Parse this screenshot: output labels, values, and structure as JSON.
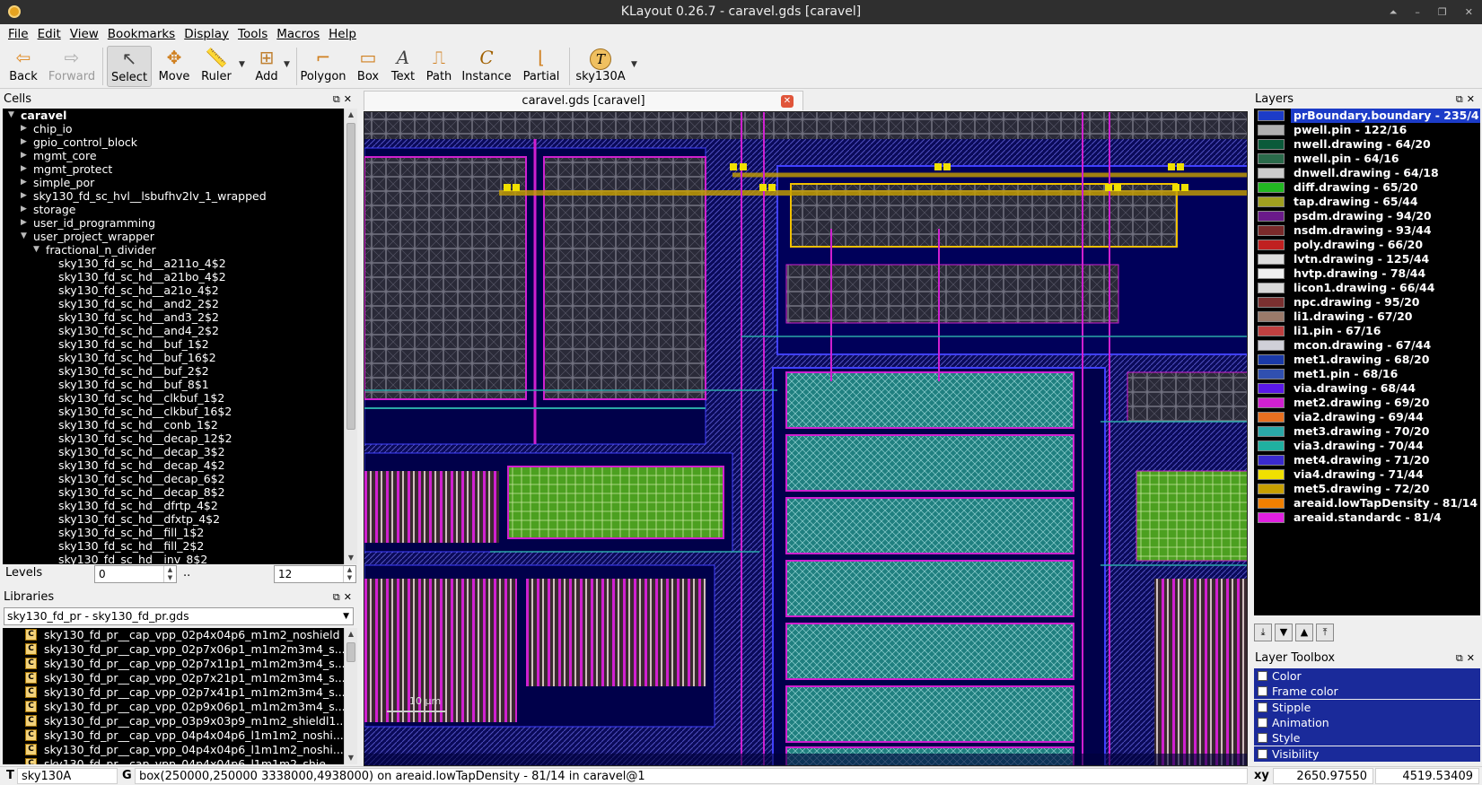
{
  "window": {
    "title": "KLayout 0.26.7 - caravel.gds [caravel]"
  },
  "menu": [
    "File",
    "Edit",
    "View",
    "Bookmarks",
    "Display",
    "Tools",
    "Macros",
    "Help"
  ],
  "toolbar": {
    "back": "Back",
    "forward": "Forward",
    "select": "Select",
    "move": "Move",
    "ruler": "Ruler",
    "add": "Add",
    "polygon": "Polygon",
    "box": "Box",
    "text": "Text",
    "path": "Path",
    "instance": "Instance",
    "partial": "Partial",
    "tech": "sky130A"
  },
  "cells_panel": {
    "title": "Cells",
    "tree": [
      {
        "label": "caravel",
        "depth": 0,
        "expander": "open",
        "bold": true
      },
      {
        "label": "chip_io",
        "depth": 1,
        "expander": "closed"
      },
      {
        "label": "gpio_control_block",
        "depth": 1,
        "expander": "closed"
      },
      {
        "label": "mgmt_core",
        "depth": 1,
        "expander": "closed"
      },
      {
        "label": "mgmt_protect",
        "depth": 1,
        "expander": "closed"
      },
      {
        "label": "simple_por",
        "depth": 1,
        "expander": "closed"
      },
      {
        "label": "sky130_fd_sc_hvl__lsbufhv2lv_1_wrapped",
        "depth": 1,
        "expander": "closed"
      },
      {
        "label": "storage",
        "depth": 1,
        "expander": "closed"
      },
      {
        "label": "user_id_programming",
        "depth": 1,
        "expander": "closed"
      },
      {
        "label": "user_project_wrapper",
        "depth": 1,
        "expander": "open"
      },
      {
        "label": "fractional_n_divider",
        "depth": 2,
        "expander": "open"
      },
      {
        "label": "sky130_fd_sc_hd__a211o_4$2",
        "depth": 3,
        "expander": "none"
      },
      {
        "label": "sky130_fd_sc_hd__a21bo_4$2",
        "depth": 3,
        "expander": "none"
      },
      {
        "label": "sky130_fd_sc_hd__a21o_4$2",
        "depth": 3,
        "expander": "none"
      },
      {
        "label": "sky130_fd_sc_hd__and2_2$2",
        "depth": 3,
        "expander": "none"
      },
      {
        "label": "sky130_fd_sc_hd__and3_2$2",
        "depth": 3,
        "expander": "none"
      },
      {
        "label": "sky130_fd_sc_hd__and4_2$2",
        "depth": 3,
        "expander": "none"
      },
      {
        "label": "sky130_fd_sc_hd__buf_1$2",
        "depth": 3,
        "expander": "none"
      },
      {
        "label": "sky130_fd_sc_hd__buf_16$2",
        "depth": 3,
        "expander": "none"
      },
      {
        "label": "sky130_fd_sc_hd__buf_2$2",
        "depth": 3,
        "expander": "none"
      },
      {
        "label": "sky130_fd_sc_hd__buf_8$1",
        "depth": 3,
        "expander": "none"
      },
      {
        "label": "sky130_fd_sc_hd__clkbuf_1$2",
        "depth": 3,
        "expander": "none"
      },
      {
        "label": "sky130_fd_sc_hd__clkbuf_16$2",
        "depth": 3,
        "expander": "none"
      },
      {
        "label": "sky130_fd_sc_hd__conb_1$2",
        "depth": 3,
        "expander": "none"
      },
      {
        "label": "sky130_fd_sc_hd__decap_12$2",
        "depth": 3,
        "expander": "none"
      },
      {
        "label": "sky130_fd_sc_hd__decap_3$2",
        "depth": 3,
        "expander": "none"
      },
      {
        "label": "sky130_fd_sc_hd__decap_4$2",
        "depth": 3,
        "expander": "none"
      },
      {
        "label": "sky130_fd_sc_hd__decap_6$2",
        "depth": 3,
        "expander": "none"
      },
      {
        "label": "sky130_fd_sc_hd__decap_8$2",
        "depth": 3,
        "expander": "none"
      },
      {
        "label": "sky130_fd_sc_hd__dfrtp_4$2",
        "depth": 3,
        "expander": "none"
      },
      {
        "label": "sky130_fd_sc_hd__dfxtp_4$2",
        "depth": 3,
        "expander": "none"
      },
      {
        "label": "sky130_fd_sc_hd__fill_1$2",
        "depth": 3,
        "expander": "none"
      },
      {
        "label": "sky130_fd_sc_hd__fill_2$2",
        "depth": 3,
        "expander": "none"
      },
      {
        "label": "sky130_fd_sc_hd__inv_8$2",
        "depth": 3,
        "expander": "none"
      }
    ]
  },
  "levels": {
    "label": "Levels",
    "min": "0",
    "sep": "..",
    "max": "12"
  },
  "libraries_panel": {
    "title": "Libraries",
    "selected": "sky130_fd_pr - sky130_fd_pr.gds",
    "items": [
      "sky130_fd_pr__cap_vpp_02p4x04p6_m1m2_noshield",
      "sky130_fd_pr__cap_vpp_02p7x06p1_m1m2m3m4_s...",
      "sky130_fd_pr__cap_vpp_02p7x11p1_m1m2m3m4_s...",
      "sky130_fd_pr__cap_vpp_02p7x21p1_m1m2m3m4_s...",
      "sky130_fd_pr__cap_vpp_02p7x41p1_m1m2m3m4_s...",
      "sky130_fd_pr__cap_vpp_02p9x06p1_m1m2m3m4_s...",
      "sky130_fd_pr__cap_vpp_03p9x03p9_m1m2_shieldl1...",
      "sky130_fd_pr__cap_vpp_04p4x04p6_l1m1m2_noshi...",
      "sky130_fd_pr__cap_vpp_04p4x04p6_l1m1m2_noshi...",
      "sky130_fd_pr__cap_vpp_04p4x04p6_l1m1m2_shie..."
    ]
  },
  "canvas": {
    "tab_label": "caravel.gds [caravel]",
    "scale_label": "10 µm"
  },
  "layers_panel": {
    "title": "Layers",
    "layers": [
      {
        "name": "prBoundary.boundary - 235/4",
        "color": "#1c3cc8",
        "selected": true
      },
      {
        "name": "pwell.pin - 122/16",
        "color": "#b0b0b0"
      },
      {
        "name": "nwell.drawing - 64/20",
        "color": "#0a5a3a"
      },
      {
        "name": "nwell.pin - 64/16",
        "color": "#2a6a4a"
      },
      {
        "name": "dnwell.drawing - 64/18",
        "color": "#cccccc"
      },
      {
        "name": "diff.drawing - 65/20",
        "color": "#22b822"
      },
      {
        "name": "tap.drawing - 65/44",
        "color": "#a0a020"
      },
      {
        "name": "psdm.drawing - 94/20",
        "color": "#6a1a8a"
      },
      {
        "name": "nsdm.drawing - 93/44",
        "color": "#7a2a2a"
      },
      {
        "name": "poly.drawing - 66/20",
        "color": "#c02020"
      },
      {
        "name": "lvtn.drawing - 125/44",
        "color": "#dddddd"
      },
      {
        "name": "hvtp.drawing - 78/44",
        "color": "#f0f0f0"
      },
      {
        "name": "licon1.drawing - 66/44",
        "color": "#d8d8d8"
      },
      {
        "name": "npc.drawing - 95/20",
        "color": "#7a3030"
      },
      {
        "name": "li1.drawing - 67/20",
        "color": "#9a7a6a"
      },
      {
        "name": "li1.pin - 67/16",
        "color": "#c04040"
      },
      {
        "name": "mcon.drawing - 67/44",
        "color": "#d0d0d8"
      },
      {
        "name": "met1.drawing - 68/20",
        "color": "#1a3aa8"
      },
      {
        "name": "met1.pin - 68/16",
        "color": "#3050b0"
      },
      {
        "name": "via.drawing - 68/44",
        "color": "#5a18e8"
      },
      {
        "name": "met2.drawing - 69/20",
        "color": "#d020d0"
      },
      {
        "name": "via2.drawing - 69/44",
        "color": "#e87020"
      },
      {
        "name": "met3.drawing - 70/20",
        "color": "#2aa8a8"
      },
      {
        "name": "via3.drawing - 70/44",
        "color": "#20b0a0"
      },
      {
        "name": "met4.drawing - 71/20",
        "color": "#3a2ad0"
      },
      {
        "name": "via4.drawing - 71/44",
        "color": "#f0e000"
      },
      {
        "name": "met5.drawing - 72/20",
        "color": "#c8a000"
      },
      {
        "name": "areaid.lowTapDensity - 81/14",
        "color": "#f08000"
      },
      {
        "name": "areaid.standardc - 81/4",
        "color": "#e020e0"
      }
    ]
  },
  "layer_toolbox": {
    "title": "Layer Toolbox",
    "sections": [
      "Color",
      "Frame color",
      "Stipple",
      "Animation",
      "Style",
      "Visibility"
    ]
  },
  "status": {
    "mode_key": "T",
    "tech": "sky130A",
    "grid_key": "G",
    "message": "box(250000,250000 3338000,4938000) on areaid.lowTapDensity - 81/14 in caravel@1",
    "coord_label": "xy",
    "x": "2650.97550",
    "y": "4519.53409"
  }
}
